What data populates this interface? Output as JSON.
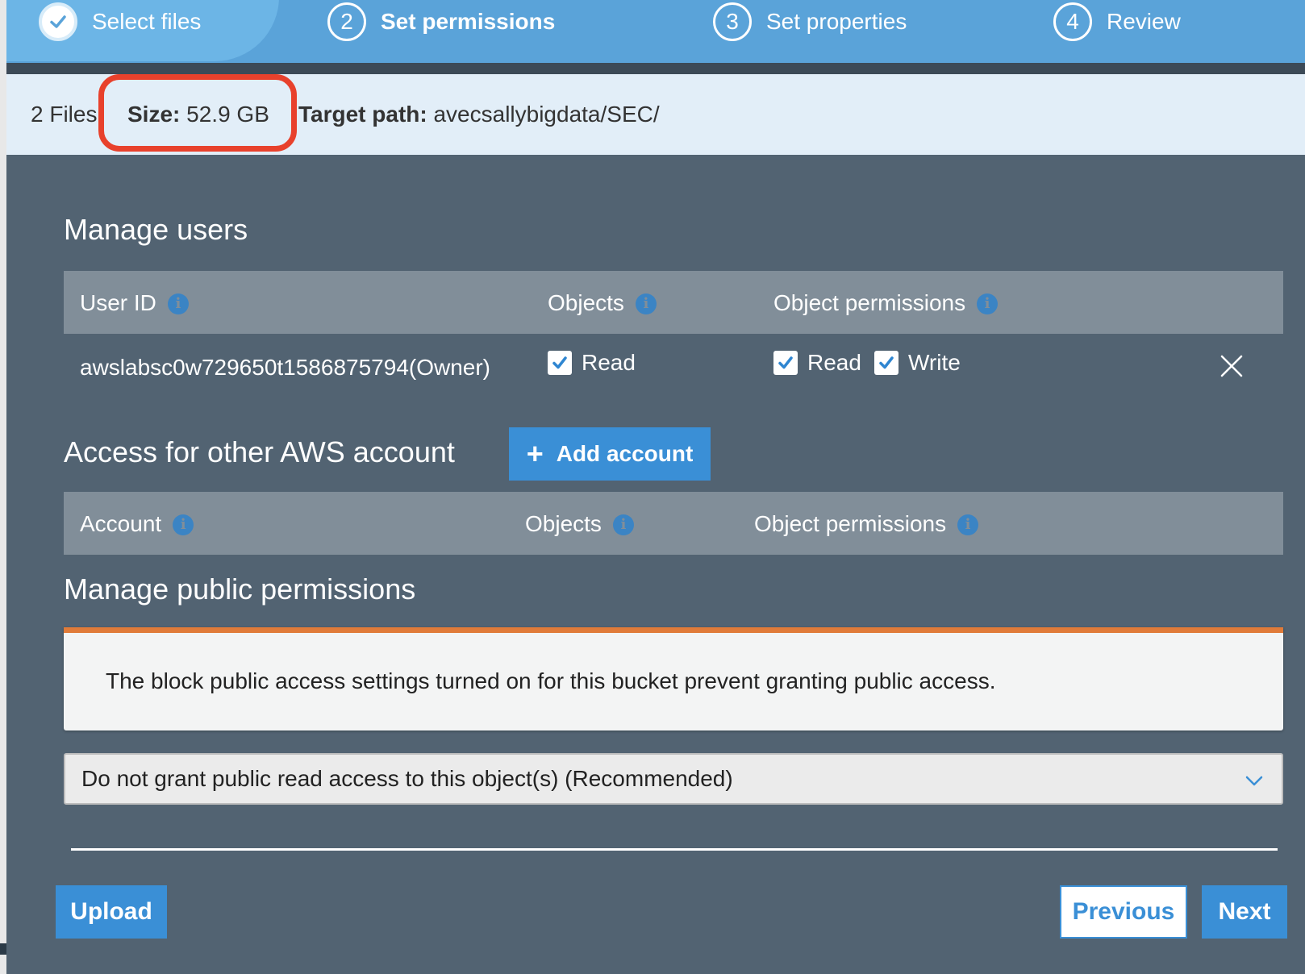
{
  "wizard": {
    "steps": [
      {
        "number": "1",
        "label": "Select files",
        "state": "completed"
      },
      {
        "number": "2",
        "label": "Set permissions",
        "state": "current"
      },
      {
        "number": "3",
        "label": "Set properties",
        "state": "upcoming"
      },
      {
        "number": "4",
        "label": "Review",
        "state": "upcoming"
      }
    ]
  },
  "summary": {
    "files": "2 Files",
    "size_label": "Size:",
    "size_value": "52.9 GB",
    "path_label": "Target path:",
    "path_value": "avecsallybigdata/SEC/"
  },
  "manage_users": {
    "title": "Manage users",
    "headers": {
      "user_id": "User ID",
      "objects": "Objects",
      "object_permissions": "Object permissions"
    },
    "rows": [
      {
        "user_id": "awslabsc0w729650t1586875794(Owner)",
        "objects_read": "Read",
        "perm_read": "Read",
        "perm_write": "Write"
      }
    ]
  },
  "other_accounts": {
    "title": "Access for other AWS account",
    "add_button": "Add account",
    "headers": {
      "account": "Account",
      "objects": "Objects",
      "object_permissions": "Object permissions"
    }
  },
  "public_permissions": {
    "title": "Manage public permissions",
    "warning": "The block public access settings turned on for this bucket prevent granting public access.",
    "select_value": "Do not grant public read access to this object(s) (Recommended)"
  },
  "footer": {
    "upload": "Upload",
    "previous": "Previous",
    "next": "Next"
  },
  "colors": {
    "accent": "#3a8fd6",
    "panel": "#526372",
    "warning_bar": "#e07b39",
    "highlight": "#e8412c"
  }
}
